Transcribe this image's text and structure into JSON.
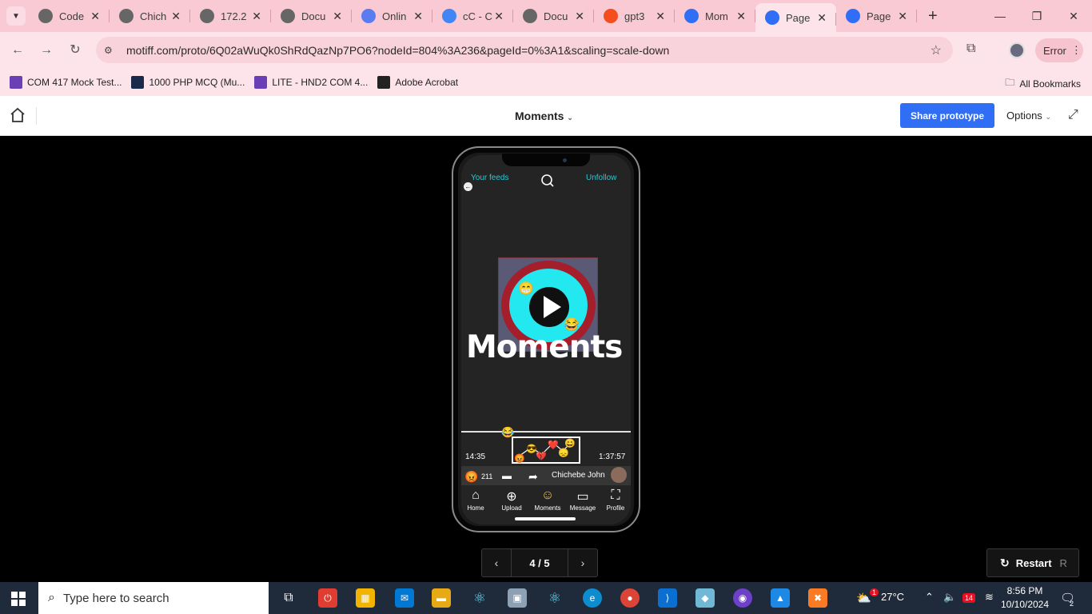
{
  "browser": {
    "tabs": [
      {
        "title": "Code",
        "icon": "globe-icon",
        "color": "#666666"
      },
      {
        "title": "Chich",
        "icon": "globe-icon",
        "color": "#666666"
      },
      {
        "title": "172.2",
        "icon": "globe-icon",
        "color": "#666666"
      },
      {
        "title": "Docu",
        "icon": "globe-icon",
        "color": "#666666"
      },
      {
        "title": "Onlin",
        "icon": "online-icon",
        "color": "#5b7cf0"
      },
      {
        "title": "cC - C",
        "icon": "google-icon",
        "color": "#4285f4"
      },
      {
        "title": "Docu",
        "icon": "globe-icon",
        "color": "#666666"
      },
      {
        "title": "gpt3",
        "icon": "figma-icon",
        "color": "#f24e1e"
      },
      {
        "title": "Mom",
        "icon": "motiff-icon",
        "color": "#2f6ef5"
      },
      {
        "title": "Page",
        "icon": "motiff-icon",
        "color": "#2f6ef5"
      },
      {
        "title": "Page",
        "icon": "motiff-icon",
        "color": "#2f6ef5"
      }
    ],
    "active_tab_index": 9,
    "url": "motiff.com/proto/6Q02aWuQk0ShRdQazNp7PO6?nodeId=804%3A236&pageId=0%3A1&scaling=scale-down",
    "error_label": "Error",
    "bookmarks": [
      {
        "label": "COM 417 Mock Test...",
        "icon": "forms-icon",
        "color": "#6a3fb5"
      },
      {
        "label": "1000 PHP MCQ (Mu...",
        "icon": "sf-icon",
        "color": "#1a2a4a"
      },
      {
        "label": "LITE - HND2 COM 4...",
        "icon": "forms-icon",
        "color": "#6a3fb5"
      },
      {
        "label": "Adobe Acrobat",
        "icon": "globe-icon",
        "color": "#222222"
      }
    ],
    "all_bookmarks": "All Bookmarks"
  },
  "motiff": {
    "title": "Moments",
    "share_label": "Share prototype",
    "options_label": "Options",
    "pager": {
      "current": "4 / 5"
    },
    "restart_label": "Restart",
    "restart_key": "R"
  },
  "prototype": {
    "top_left": "Your feeds",
    "top_right": "Unfollow",
    "logo_text": "Moments",
    "time_elapsed": "14:35",
    "time_total": "1:37:57",
    "reaction_count": "211",
    "username": "Chichebe John",
    "nav": [
      "Home",
      "Upload",
      "Moments",
      "Message",
      "Profile"
    ]
  },
  "taskbar": {
    "search_placeholder": "Type here to search",
    "temperature": "27°C",
    "time": "8:56 PM",
    "date": "10/10/2024",
    "weather_badge": "1",
    "calendar_badge": "14",
    "notif_count": "2"
  }
}
